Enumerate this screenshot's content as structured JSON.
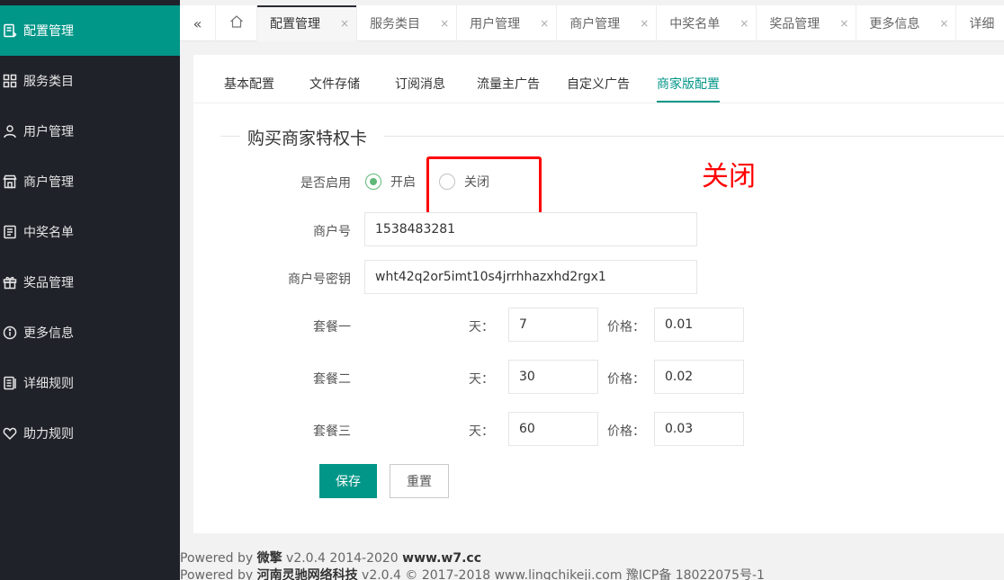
{
  "sidebar": {
    "items": [
      {
        "label": "配置管理",
        "icon": "config-icon",
        "active": true
      },
      {
        "label": "服务类目",
        "icon": "grid-icon",
        "active": false
      },
      {
        "label": "用户管理",
        "icon": "user-icon",
        "active": false
      },
      {
        "label": "商户管理",
        "icon": "store-icon",
        "active": false
      },
      {
        "label": "中奖名单",
        "icon": "list-icon",
        "active": false
      },
      {
        "label": "奖品管理",
        "icon": "gift-icon",
        "active": false
      },
      {
        "label": "更多信息",
        "icon": "info-icon",
        "active": false
      },
      {
        "label": "详细规则",
        "icon": "rules-icon",
        "active": false
      },
      {
        "label": "助力规则",
        "icon": "heart-icon",
        "active": false
      }
    ]
  },
  "tabbar": {
    "collapse_glyph": "«",
    "home_icon": "home-icon",
    "close_glyph": "×",
    "tabs": [
      {
        "label": "配置管理",
        "active": true
      },
      {
        "label": "服务类目",
        "active": false
      },
      {
        "label": "用户管理",
        "active": false
      },
      {
        "label": "商户管理",
        "active": false
      },
      {
        "label": "中奖名单",
        "active": false
      },
      {
        "label": "奖品管理",
        "active": false
      },
      {
        "label": "更多信息",
        "active": false
      },
      {
        "label": "详细",
        "active": false
      }
    ]
  },
  "subtabs": [
    {
      "label": "基本配置"
    },
    {
      "label": "文件存储"
    },
    {
      "label": "订阅消息"
    },
    {
      "label": "流量主广告"
    },
    {
      "label": "自定义广告"
    },
    {
      "label": "商家版配置",
      "active": true
    }
  ],
  "form": {
    "legend": "购买商家特权卡",
    "enable_label": "是否启用",
    "enable_on": "开启",
    "enable_off": "关闭",
    "enable_value": "开启",
    "merchant_no_label": "商户号",
    "merchant_no_value": "1538483281",
    "merchant_key_label": "商户号密钥",
    "merchant_key_value": "wht42q2or5imt10s4jrrhhazxhd2rgx1",
    "days_label": "天：",
    "price_label": "价格：",
    "packages": [
      {
        "name": "套餐一",
        "days": "7",
        "price": "0.01"
      },
      {
        "name": "套餐二",
        "days": "30",
        "price": "0.02"
      },
      {
        "name": "套餐三",
        "days": "60",
        "price": "0.03"
      }
    ],
    "save_label": "保存",
    "reset_label": "重置"
  },
  "annotation": {
    "text": "关闭",
    "color": "#ff0000"
  },
  "footer": {
    "line1_prefix": "Powered by ",
    "line1_brand": "微擎",
    "line1_mid": " v2.0.4 2014-2020 ",
    "line1_site": "www.w7.cc",
    "line2_prefix": "Powered by ",
    "line2_brand": "河南灵驰网络科技",
    "line2_rest": " v2.0.4 © 2017-2018 www.lingchikeji.com 豫ICP备 18022075号-1"
  },
  "colors": {
    "accent": "#009688",
    "sidebar_bg": "#20222a",
    "radio_on": "#5FB878"
  }
}
